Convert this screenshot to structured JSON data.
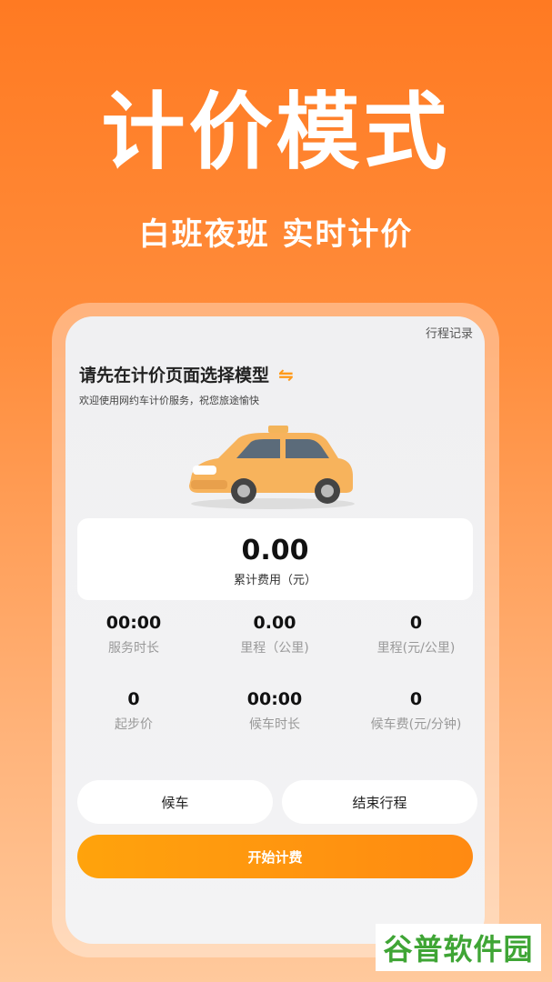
{
  "hero": {
    "title": "计价模式",
    "subtitle": "白班夜班  实时计价"
  },
  "screen": {
    "history_link": "行程记录",
    "model_prompt": "请先在计价页面选择模型",
    "switch_icon": "switch-arrows-icon",
    "welcome": "欢迎使用网约车计价服务，祝您旅途愉快",
    "fee": {
      "value": "0.00",
      "label": "累计费用（元）"
    },
    "stats": [
      {
        "value": "00:00",
        "label": "服务时长"
      },
      {
        "value": "0.00",
        "label": "里程（公里)"
      },
      {
        "value": "0",
        "label": "里程(元/公里)"
      },
      {
        "value": "0",
        "label": "起步价"
      },
      {
        "value": "00:00",
        "label": "候车时长"
      },
      {
        "value": "0",
        "label": "候车费(元/分钟)"
      }
    ],
    "buttons": {
      "wait": "候车",
      "end_trip": "结束行程",
      "start": "开始计费"
    }
  },
  "watermark": "谷普软件园",
  "colors": {
    "accent": "#ff8a12",
    "background_top": "#ff7a22",
    "watermark_green": "#3fa535"
  }
}
